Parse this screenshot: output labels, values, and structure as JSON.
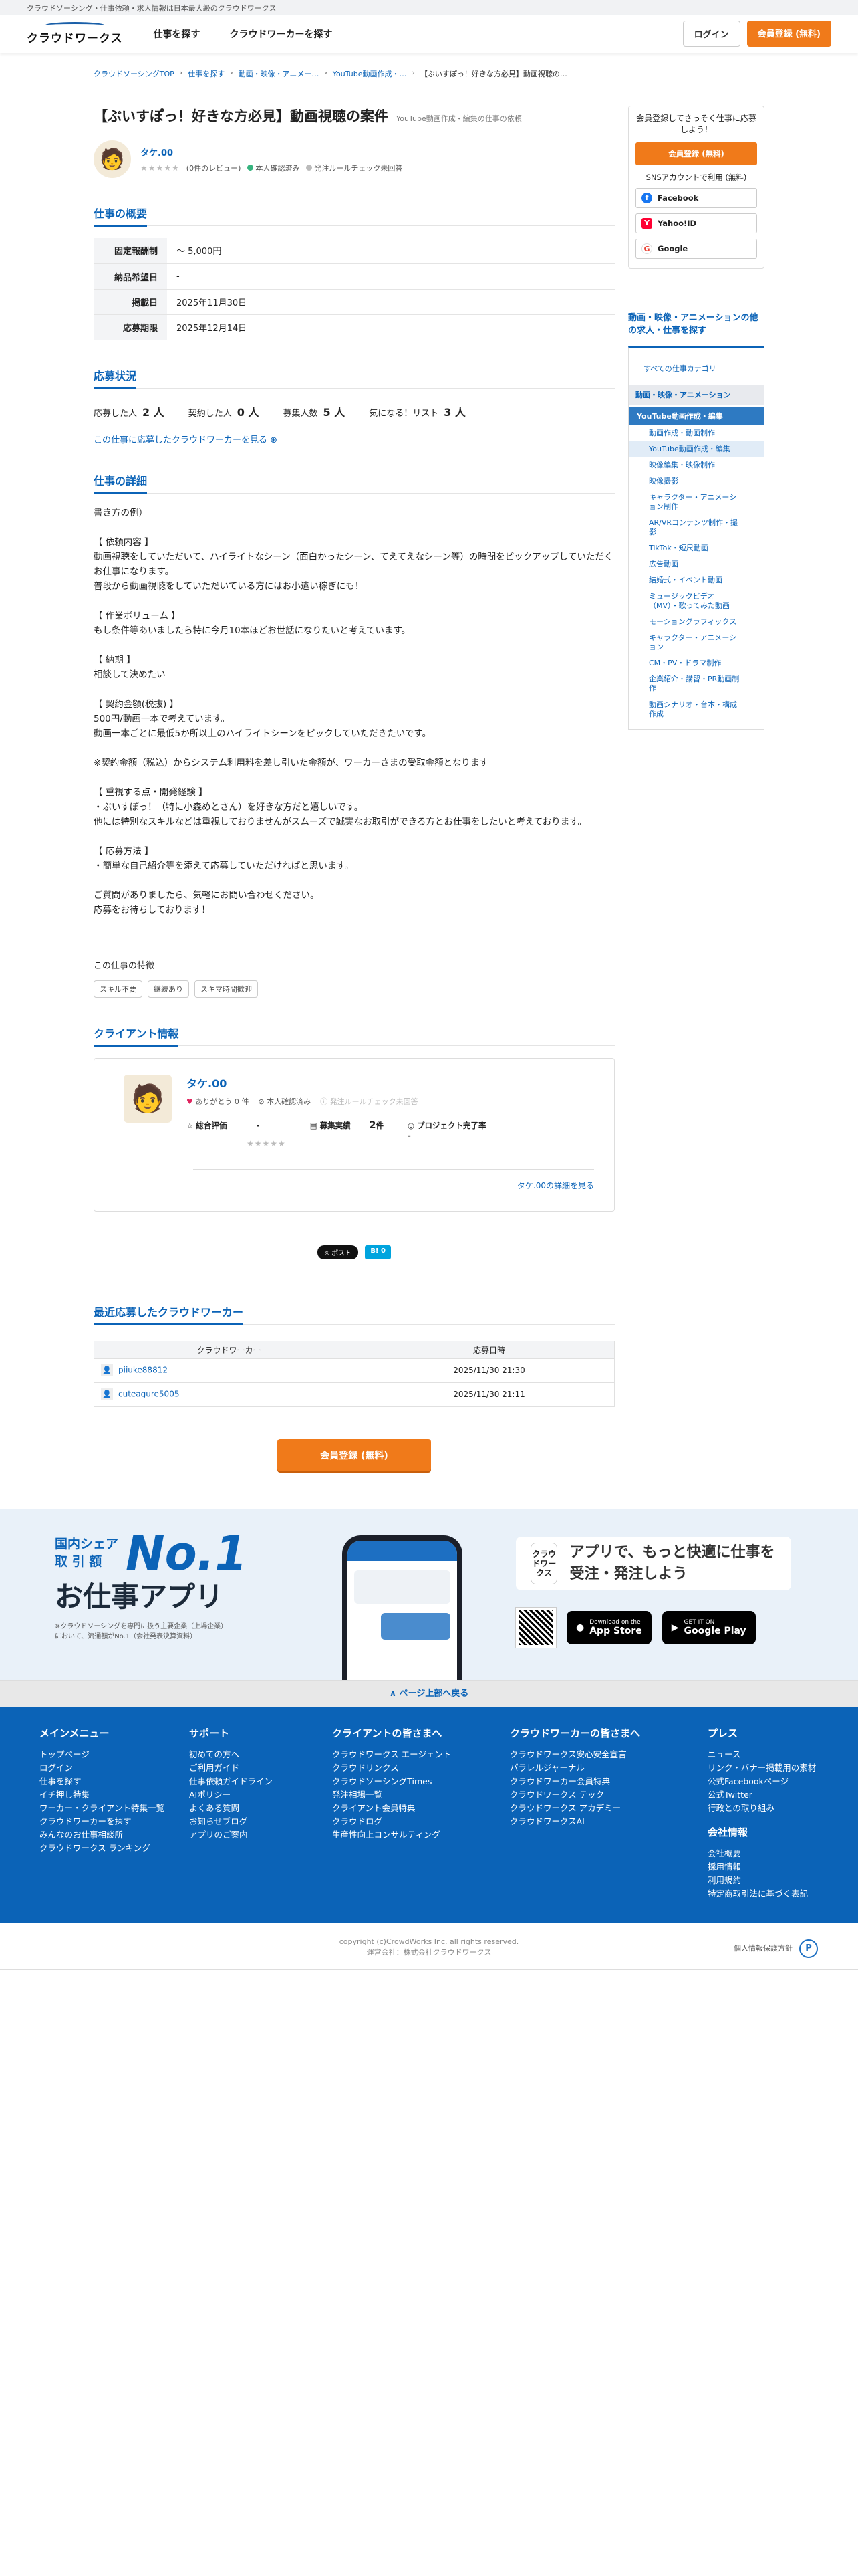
{
  "topbar": {
    "text": "クラウドソーシング・仕事依頼・求人情報は日本最大級のクラウドワークス"
  },
  "header": {
    "logo": "クラウドワークス",
    "nav": [
      "仕事を探す",
      "クラウドワーカーを探す"
    ],
    "login": "ログイン",
    "register": "会員登録 (無料)"
  },
  "breadcrumbs": [
    "クラウドソーシングTOP",
    "仕事を探す",
    "動画・映像・アニメー…",
    "YouTube動画作成・…",
    "【ぶいすぽっ！好きな方必見】動画視聴の…"
  ],
  "job": {
    "title": "【ぶいすぽっ！好きな方必見】動画視聴の案件",
    "category": "YouTube動画作成・編集の仕事の依頼",
    "client": "タケ.00",
    "stars": "★★★★★",
    "review": "(0件のレビュー)",
    "verified": "本人確認済み",
    "rulecheck": "発注ルールチェック未回答"
  },
  "overview": {
    "heading": "仕事の概要",
    "rows": [
      {
        "k": "固定報酬制",
        "v": "〜 5,000円"
      },
      {
        "k": "納品希望日",
        "v": "-"
      },
      {
        "k": "掲載日",
        "v": "2025年11月30日"
      },
      {
        "k": "応募期限",
        "v": "2025年12月14日"
      }
    ]
  },
  "status": {
    "heading": "応募状況",
    "items": [
      {
        "k": "応募した人",
        "v": "2 人"
      },
      {
        "k": "契約した人",
        "v": "0 人"
      },
      {
        "k": "募集人数",
        "v": "5 人"
      },
      {
        "k": "気になる！リスト",
        "v": "3 人"
      }
    ],
    "link": "この仕事に応募したクラウドワーカーを見る ⊕"
  },
  "detail": {
    "heading": "仕事の詳細",
    "body": "書き方の例）\n\n【 依頼内容 】\n動画視聴をしていただいて、ハイライトなシーン（面白かったシーン、てえてえなシーン等）の時間をピックアップしていただくお仕事になります。\n普段から動画視聴をしていただいている方にはお小遣い稼ぎにも！\n\n【 作業ボリューム 】\nもし条件等あいましたら特に今月10本ほどお世話になりたいと考えています。\n\n【 納期 】\n相談して決めたい\n\n【 契約金額(税抜) 】\n500円/動画一本で考えています。\n動画一本ごとに最低5か所以上のハイライトシーンをピックしていただきたいです。\n\n※契約金額（税込）からシステム利用料を差し引いた金額が、ワーカーさまの受取金額となります\n\n【 重視する点・開発経験 】\n・ぶいすぽっ！（特に小森めとさん）を好きな方だと嬉しいです。\n他には特別なスキルなどは重視しておりませんがスムーズで誠実なお取引ができる方とお仕事をしたいと考えております。\n\n【 応募方法 】\n・簡単な自己紹介等を添えて応募していただければと思います。\n\nご質問がありましたら、気軽にお問い合わせください。\n応募をお待ちしております！"
  },
  "features": {
    "heading": "この仕事の特徴",
    "tags": [
      "スキル不要",
      "継続あり",
      "スキマ時間歓迎"
    ]
  },
  "client_info": {
    "heading": "クライアント情報",
    "name": "タケ.00",
    "thanks": "ありがとう 0 件",
    "verified": "本人確認済み",
    "rulecheck": "発注ルールチェック未回答",
    "rating_label": "総合評価",
    "rating_val": "-",
    "stars": "★★★★★",
    "record_label": "募集実績",
    "record_val": "2",
    "record_unit": "件",
    "done_label": "プロジェクト完了率",
    "done_val": "-",
    "detail_link": "タケ.00の詳細を見る"
  },
  "share": {
    "x": "𝕏 ポスト",
    "b": "B! 0"
  },
  "recent": {
    "heading": "最近応募したクラウドワーカー",
    "cols": [
      "クラウドワーカー",
      "応募日時"
    ],
    "rows": [
      {
        "name": "piiuke88812",
        "time": "2025/11/30 21:30"
      },
      {
        "name": "cuteagure5005",
        "time": "2025/11/30 21:11"
      }
    ]
  },
  "cta": "会員登録 (無料)",
  "sidebar": {
    "promo": "会員登録してさっそく仕事に応募しよう！",
    "register": "会員登録 (無料)",
    "sns_label": "SNSアカウントで利用 (無料)",
    "sns": [
      "Facebook",
      "Yahoo!ID",
      "Google"
    ],
    "cat_heading": "動画・映像・アニメーションの他の求人・仕事を探す",
    "all": "すべての仕事カテゴリ",
    "group": "動画・映像・アニメーション",
    "selected": "YouTube動画作成・編集",
    "items": [
      "動画作成・動画制作",
      "YouTube動画作成・編集",
      "映像編集・映像制作",
      "映像撮影",
      "キャラクター・アニメーション制作",
      "AR/VRコンテンツ制作・撮影",
      "TikTok・短尺動画",
      "広告動画",
      "結婚式・イベント動画",
      "ミュージックビデオ（MV）・歌ってみた動画",
      "モーショングラフィックス",
      "キャラクター・アニメーション",
      "CM・PV・ドラマ制作",
      "企業紹介・講習・PR動画制作",
      "動画シナリオ・台本・構成作成"
    ]
  },
  "app": {
    "share1": "国内シェア",
    "share2": "取 引 額",
    "no1": "No.1",
    "title": "お仕事アプリ",
    "note": "※クラウドソーシングを専門に扱う主要企業（上場企業）において、流通額がNo.1（会社発表決算資料）",
    "logo": "クラウドワークス",
    "catch": "アプリで、もっと快適に仕事を受注・発注しよう",
    "appstore_small": "Download on the",
    "appstore": "App Store",
    "gplay_small": "GET IT ON",
    "gplay": "Google Play"
  },
  "totop": "∧ ページ上部へ戻る",
  "footer": {
    "cols": [
      {
        "title": "メインメニュー",
        "items": [
          "トップページ",
          "ログイン",
          "仕事を探す",
          "イチ押し特集",
          "ワーカー・クライアント特集一覧",
          "クラウドワーカーを探す",
          "みんなのお仕事相談所",
          "クラウドワークス ランキング"
        ]
      },
      {
        "title": "サポート",
        "items": [
          "初めての方へ",
          "ご利用ガイド",
          "仕事依頼ガイドライン",
          "AIポリシー",
          "よくある質問",
          "お知らせブログ",
          "アプリのご案内"
        ]
      },
      {
        "title": "クライアントの皆さまへ",
        "items": [
          "クラウドワークス エージェント",
          "クラウドリンクス",
          "クラウドソーシングTimes",
          "発注相場一覧",
          "クライアント会員特典",
          "クラウドログ",
          "生産性向上コンサルティング"
        ]
      },
      {
        "title": "クラウドワーカーの皆さまへ",
        "items": [
          "クラウドワークス安心安全宣言",
          "パラレルジャーナル",
          "クラウドワーカー会員特典",
          "クラウドワークス テック",
          "クラウドワークス アカデミー",
          "クラウドワークスAI"
        ]
      },
      {
        "title": "プレス",
        "items": [
          "ニュース",
          "リンク・バナー掲載用の素材",
          "公式Facebookページ",
          "公式Twitter",
          "行政との取り組み"
        ]
      },
      {
        "title": "会社情報",
        "items": [
          "会社概要",
          "採用情報",
          "利用規約",
          "特定商取引法に基づく表記"
        ]
      }
    ],
    "copyright": "copyright (c)CrowdWorks Inc. all rights reserved.",
    "operator": "運営会社：株式会社クラウドワークス",
    "privacy": "個人情報保護方針"
  }
}
